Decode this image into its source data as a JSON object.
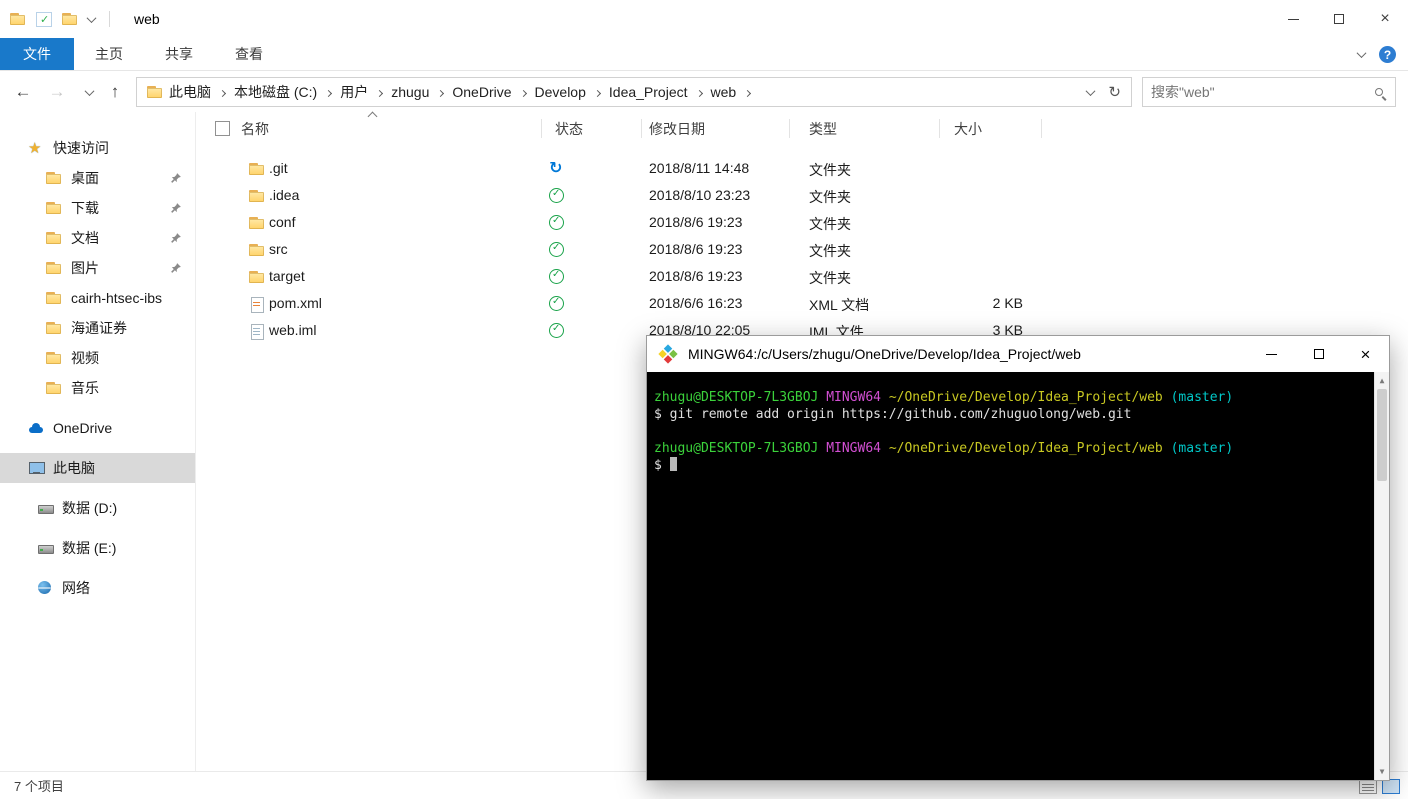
{
  "titlebar": {
    "title": "web"
  },
  "ribbon": {
    "tabs": [
      {
        "label": "文件"
      },
      {
        "label": "主页"
      },
      {
        "label": "共享"
      },
      {
        "label": "查看"
      }
    ]
  },
  "addressbar": {
    "crumbs": [
      {
        "label": "此电脑"
      },
      {
        "label": "本地磁盘 (C:)"
      },
      {
        "label": "用户"
      },
      {
        "label": "zhugu"
      },
      {
        "label": "OneDrive"
      },
      {
        "label": "Develop"
      },
      {
        "label": "Idea_Project"
      },
      {
        "label": "web"
      }
    ],
    "search_placeholder": "搜索\"web\""
  },
  "sidebar": {
    "items": [
      {
        "label": "快速访问",
        "icon": "star"
      },
      {
        "label": "桌面",
        "icon": "folder",
        "pinned": true
      },
      {
        "label": "下载",
        "icon": "folder",
        "pinned": true
      },
      {
        "label": "文档",
        "icon": "folder",
        "pinned": true
      },
      {
        "label": "图片",
        "icon": "folder",
        "pinned": true
      },
      {
        "label": "cairh-htsec-ibs",
        "icon": "folder"
      },
      {
        "label": "海通证券",
        "icon": "folder"
      },
      {
        "label": "视频",
        "icon": "folder"
      },
      {
        "label": "音乐",
        "icon": "folder"
      },
      {
        "label": "OneDrive",
        "icon": "cloud"
      },
      {
        "label": "此电脑",
        "icon": "pc",
        "selected": true
      },
      {
        "label": "数据 (D:)",
        "icon": "drive"
      },
      {
        "label": "数据 (E:)",
        "icon": "drive"
      },
      {
        "label": "网络",
        "icon": "globe"
      }
    ]
  },
  "filelist": {
    "columns": {
      "name": "名称",
      "status": "状态",
      "date": "修改日期",
      "type": "类型",
      "size": "大小"
    },
    "rows": [
      {
        "name": ".git",
        "icon": "folder",
        "status": "sync",
        "date": "2018/8/11 14:48",
        "type": "文件夹",
        "size": ""
      },
      {
        "name": ".idea",
        "icon": "folder",
        "status": "check",
        "date": "2018/8/10 23:23",
        "type": "文件夹",
        "size": ""
      },
      {
        "name": "conf",
        "icon": "folder",
        "status": "check",
        "date": "2018/8/6 19:23",
        "type": "文件夹",
        "size": ""
      },
      {
        "name": "src",
        "icon": "folder",
        "status": "check",
        "date": "2018/8/6 19:23",
        "type": "文件夹",
        "size": ""
      },
      {
        "name": "target",
        "icon": "folder",
        "status": "check",
        "date": "2018/8/6 19:23",
        "type": "文件夹",
        "size": ""
      },
      {
        "name": "pom.xml",
        "icon": "xml",
        "status": "check",
        "date": "2018/6/6 16:23",
        "type": "XML 文档",
        "size": "2 KB"
      },
      {
        "name": "web.iml",
        "icon": "file",
        "status": "check",
        "date": "2018/8/10 22:05",
        "type": "IML 文件",
        "size": "3 KB"
      }
    ]
  },
  "statusbar": {
    "count": "7 个项目"
  },
  "terminal": {
    "title": "MINGW64:/c/Users/zhugu/OneDrive/Develop/Idea_Project/web",
    "prompt_user": "zhugu@DESKTOP-7L3GBOJ",
    "prompt_shell": "MINGW64",
    "prompt_path": "~/OneDrive/Develop/Idea_Project/web",
    "prompt_branch": "(master)",
    "prompt_symbol": "$",
    "command": "git remote add origin https://github.com/zhuguolong/web.git"
  },
  "icons": {
    "back": "←",
    "forward": "→",
    "up": "↑",
    "refresh": "↻",
    "minimize": "",
    "maximize": "",
    "close": "×",
    "help": "?",
    "scroll_up": "▲",
    "scroll_down": "▼"
  },
  "colors": {
    "file-tab-blue": "#1979ca",
    "selected-gray": "#d9d9d9",
    "status-green": "#1aa34a",
    "status-blue": "#0078d7",
    "folder-mid": "#ffd267",
    "term-bg": "#000000",
    "term-fg": "#e0e0e0",
    "term-green": "#3bd23b",
    "term-magenta": "#d24fd2",
    "term-yellow": "#c8c822",
    "term-cyan": "#00c8c8",
    "help-blue": "#2d7dd2"
  }
}
